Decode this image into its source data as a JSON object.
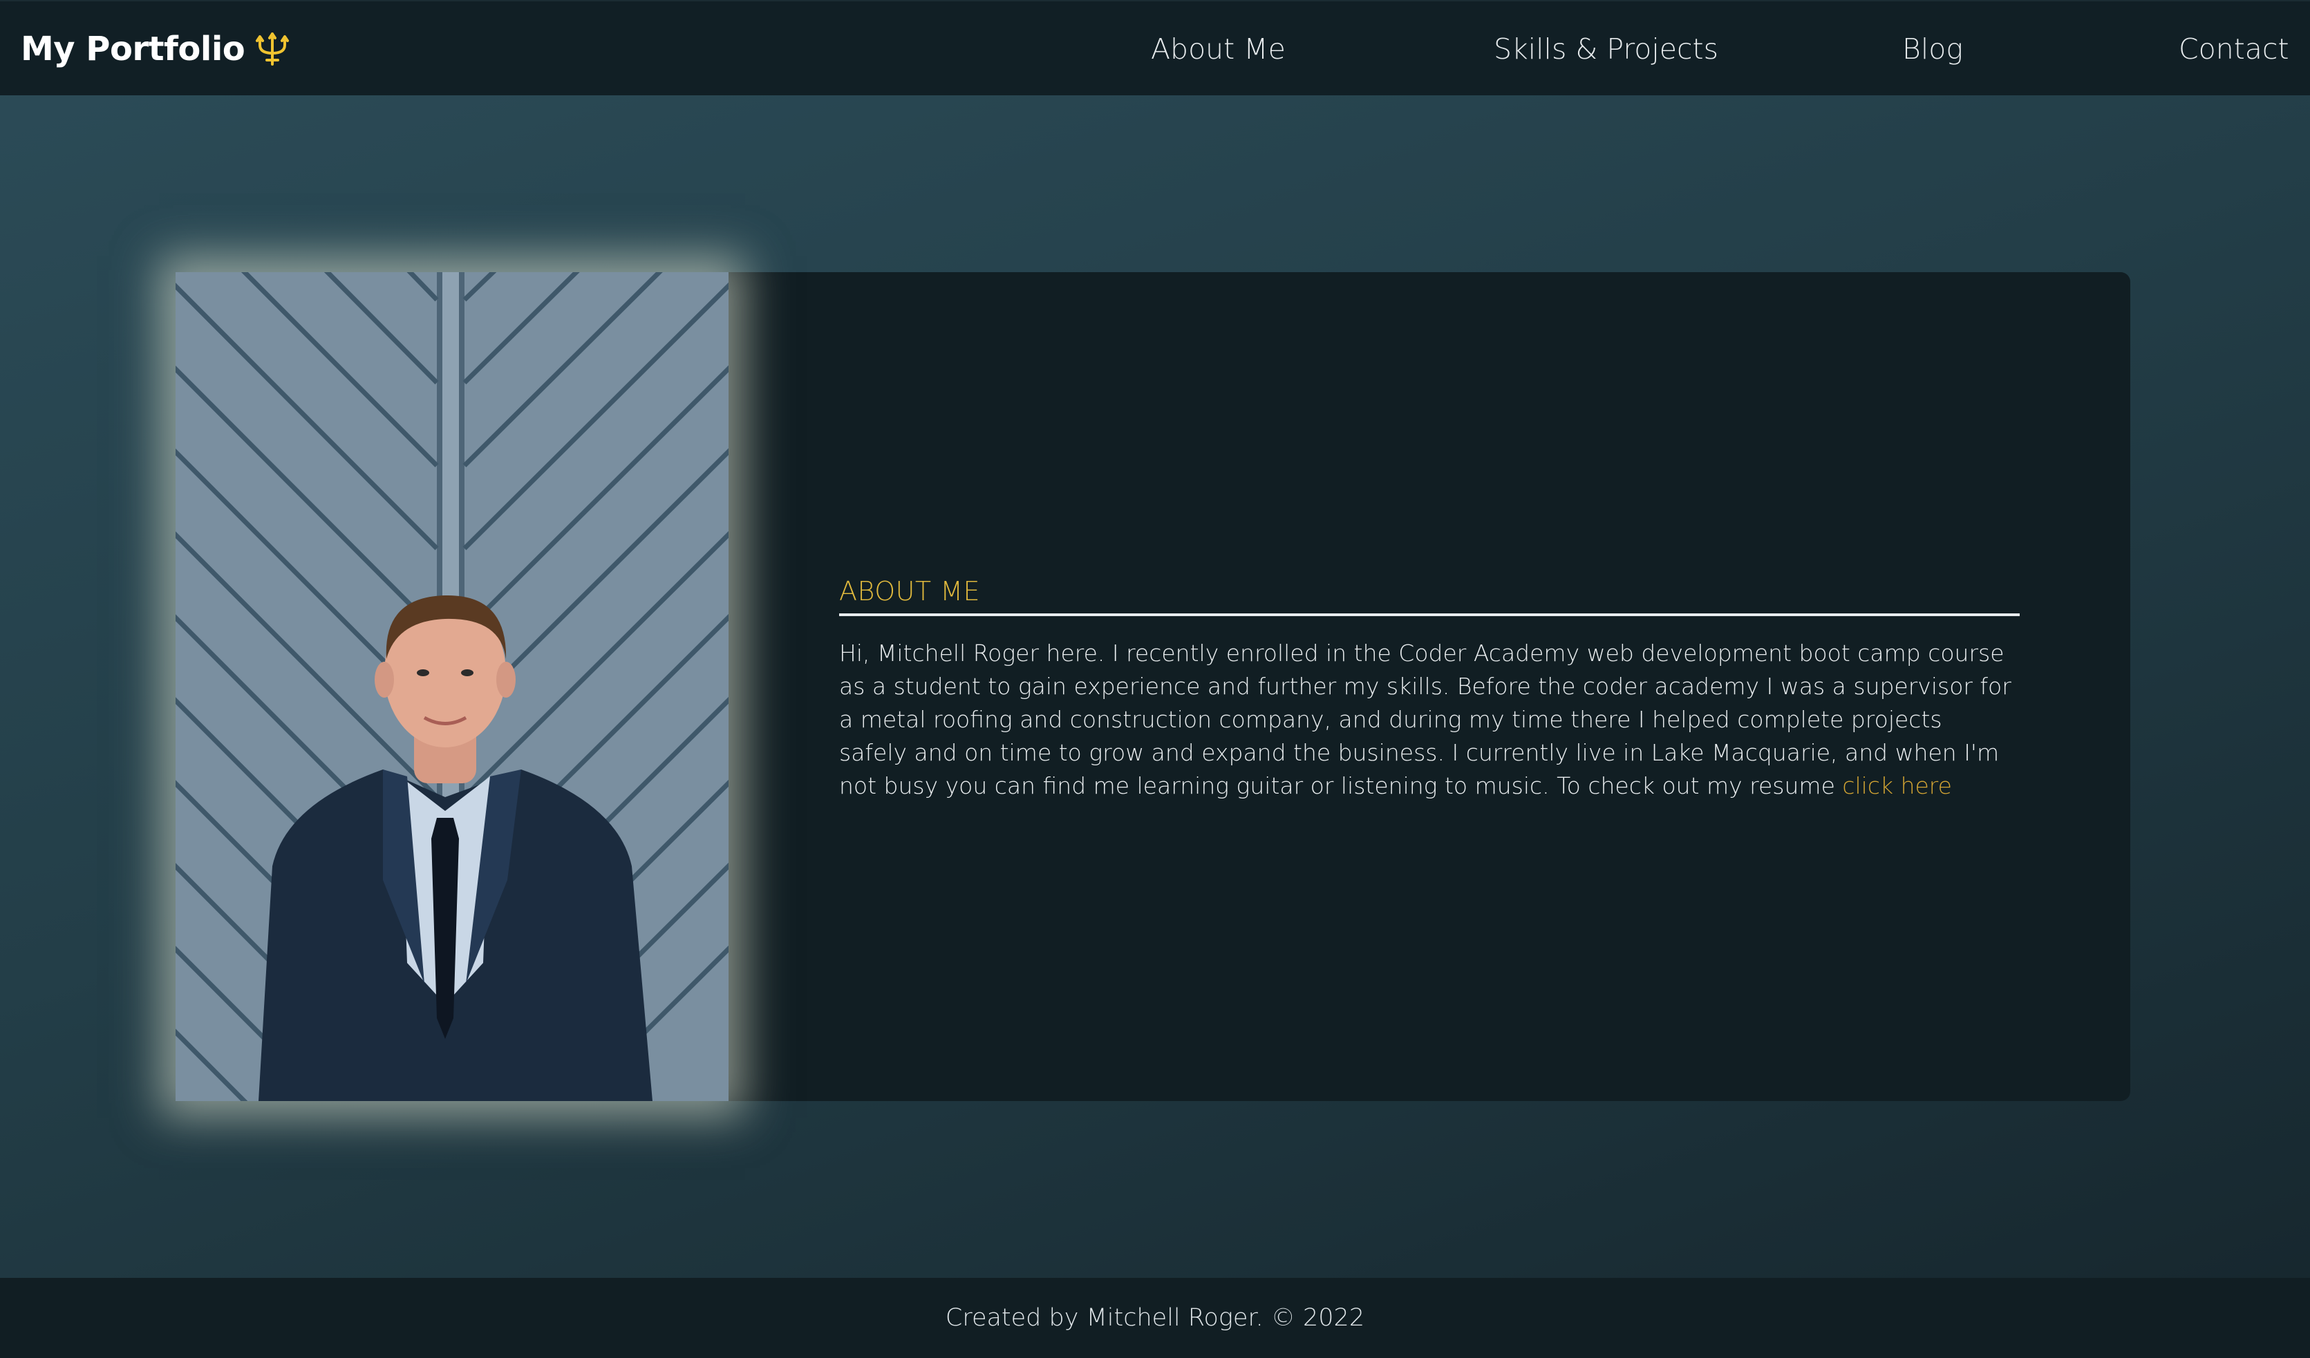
{
  "nav": {
    "brand": "My Portfolio",
    "brand_icon": "trident-icon",
    "brand_icon_color": "#f0c330",
    "items": [
      {
        "label": "About Me"
      },
      {
        "label": "Skills & Projects"
      },
      {
        "label": "Blog"
      },
      {
        "label": "Contact"
      }
    ]
  },
  "about": {
    "heading": "ABOUT ME",
    "bio": "Hi, Mitchell Roger here. I recently enrolled in the Coder Academy web development boot camp course as a student to gain experience and further my skills. Before the coder academy I was a supervisor for a metal roofing and construction company, and during my time there I helped complete projects safely and on time to grow and expand the business. I currently live in Lake Macquarie, and when I'm not busy you can find me learning guitar or listening to music. To check out my resume ",
    "resume_link": "click here",
    "photo_alt": "portrait-photo"
  },
  "footer": {
    "text": "Created by Mitchell Roger. © 2022"
  },
  "colors": {
    "accent": "#e0b93d",
    "link": "#d4a533",
    "nav_bg": "#111f25",
    "card_bg": "#111e23"
  }
}
